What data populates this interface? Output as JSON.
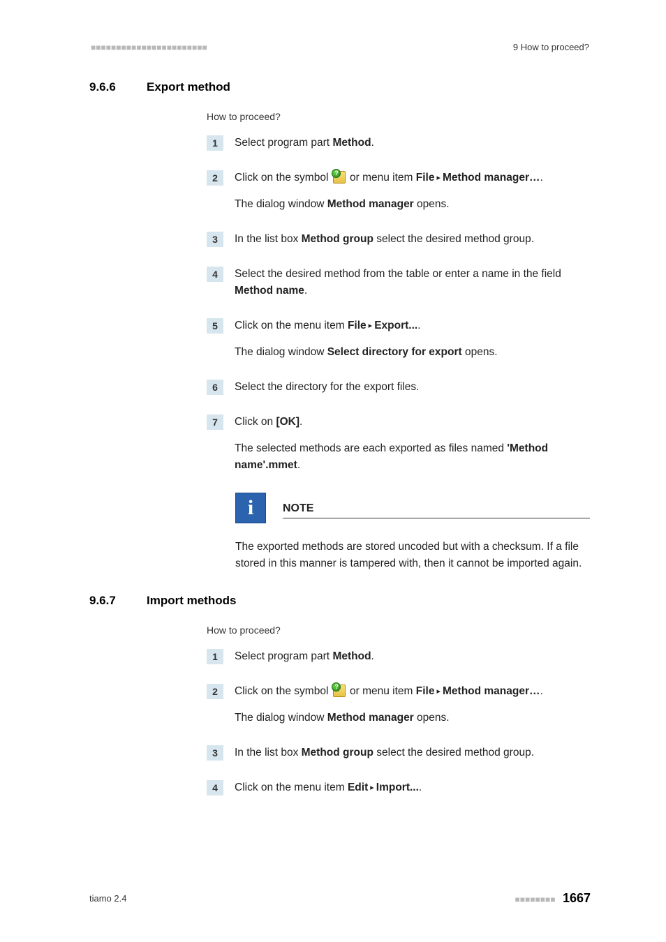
{
  "header": {
    "dots": "■■■■■■■■■■■■■■■■■■■■■■■",
    "right_label": "9 How to proceed?"
  },
  "sections": [
    {
      "id": "export",
      "number": "9.6.6",
      "title": "Export method",
      "intro": "How to proceed?",
      "steps": [
        {
          "n": "1",
          "paras": [
            {
              "parts": [
                {
                  "t": "Select program part "
                },
                {
                  "b": "Method"
                },
                {
                  "t": "."
                }
              ]
            }
          ]
        },
        {
          "n": "2",
          "paras": [
            {
              "parts": [
                {
                  "t": "Click on the symbol "
                },
                {
                  "icon": "method-manager-icon"
                },
                {
                  "t": " or menu item "
                },
                {
                  "b": "File"
                },
                {
                  "tri": "▸"
                },
                {
                  "b": "Method manager…"
                },
                {
                  "t": "."
                }
              ]
            },
            {
              "parts": [
                {
                  "t": "The dialog window "
                },
                {
                  "b": "Method manager"
                },
                {
                  "t": " opens."
                }
              ]
            }
          ]
        },
        {
          "n": "3",
          "paras": [
            {
              "parts": [
                {
                  "t": "In the list box "
                },
                {
                  "b": "Method group"
                },
                {
                  "t": " select the desired method group."
                }
              ]
            }
          ]
        },
        {
          "n": "4",
          "paras": [
            {
              "parts": [
                {
                  "t": "Select the desired method from the table or enter a name in the field "
                },
                {
                  "b": "Method name"
                },
                {
                  "t": "."
                }
              ]
            }
          ]
        },
        {
          "n": "5",
          "paras": [
            {
              "parts": [
                {
                  "t": "Click on the menu item "
                },
                {
                  "b": "File"
                },
                {
                  "tri": "▸"
                },
                {
                  "b": "Export..."
                },
                {
                  "t": "."
                }
              ]
            },
            {
              "parts": [
                {
                  "t": "The dialog window "
                },
                {
                  "b": "Select directory for export"
                },
                {
                  "t": " opens."
                }
              ]
            }
          ]
        },
        {
          "n": "6",
          "paras": [
            {
              "parts": [
                {
                  "t": "Select the directory for the export files."
                }
              ]
            }
          ]
        },
        {
          "n": "7",
          "paras": [
            {
              "parts": [
                {
                  "t": "Click on "
                },
                {
                  "b": "[OK]"
                },
                {
                  "t": "."
                }
              ]
            },
            {
              "parts": [
                {
                  "t": "The selected methods are each exported as files named "
                },
                {
                  "b": "'Method name'.mmet"
                },
                {
                  "t": "."
                }
              ]
            }
          ]
        }
      ],
      "note": {
        "title": "NOTE",
        "icon_char": "i",
        "text": "The exported methods are stored uncoded but with a checksum. If a file stored in this manner is tampered with, then it cannot be imported again."
      }
    },
    {
      "id": "import",
      "number": "9.6.7",
      "title": "Import methods",
      "intro": "How to proceed?",
      "steps": [
        {
          "n": "1",
          "paras": [
            {
              "parts": [
                {
                  "t": "Select program part "
                },
                {
                  "b": "Method"
                },
                {
                  "t": "."
                }
              ]
            }
          ]
        },
        {
          "n": "2",
          "paras": [
            {
              "parts": [
                {
                  "t": "Click on the symbol "
                },
                {
                  "icon": "method-manager-icon"
                },
                {
                  "t": " or menu item "
                },
                {
                  "b": "File"
                },
                {
                  "tri": "▸"
                },
                {
                  "b": "Method manager…"
                },
                {
                  "t": "."
                }
              ]
            },
            {
              "parts": [
                {
                  "t": "The dialog window "
                },
                {
                  "b": "Method manager"
                },
                {
                  "t": " opens."
                }
              ]
            }
          ]
        },
        {
          "n": "3",
          "paras": [
            {
              "parts": [
                {
                  "t": "In the list box "
                },
                {
                  "b": "Method group"
                },
                {
                  "t": " select the desired method group."
                }
              ]
            }
          ]
        },
        {
          "n": "4",
          "paras": [
            {
              "parts": [
                {
                  "t": "Click on the menu item "
                },
                {
                  "b": "Edit"
                },
                {
                  "tri": "▸"
                },
                {
                  "b": "Import..."
                },
                {
                  "t": "."
                }
              ]
            }
          ]
        }
      ]
    }
  ],
  "footer": {
    "left": "tiamo 2.4",
    "dots": "■■■■■■■■",
    "page": "1667"
  }
}
